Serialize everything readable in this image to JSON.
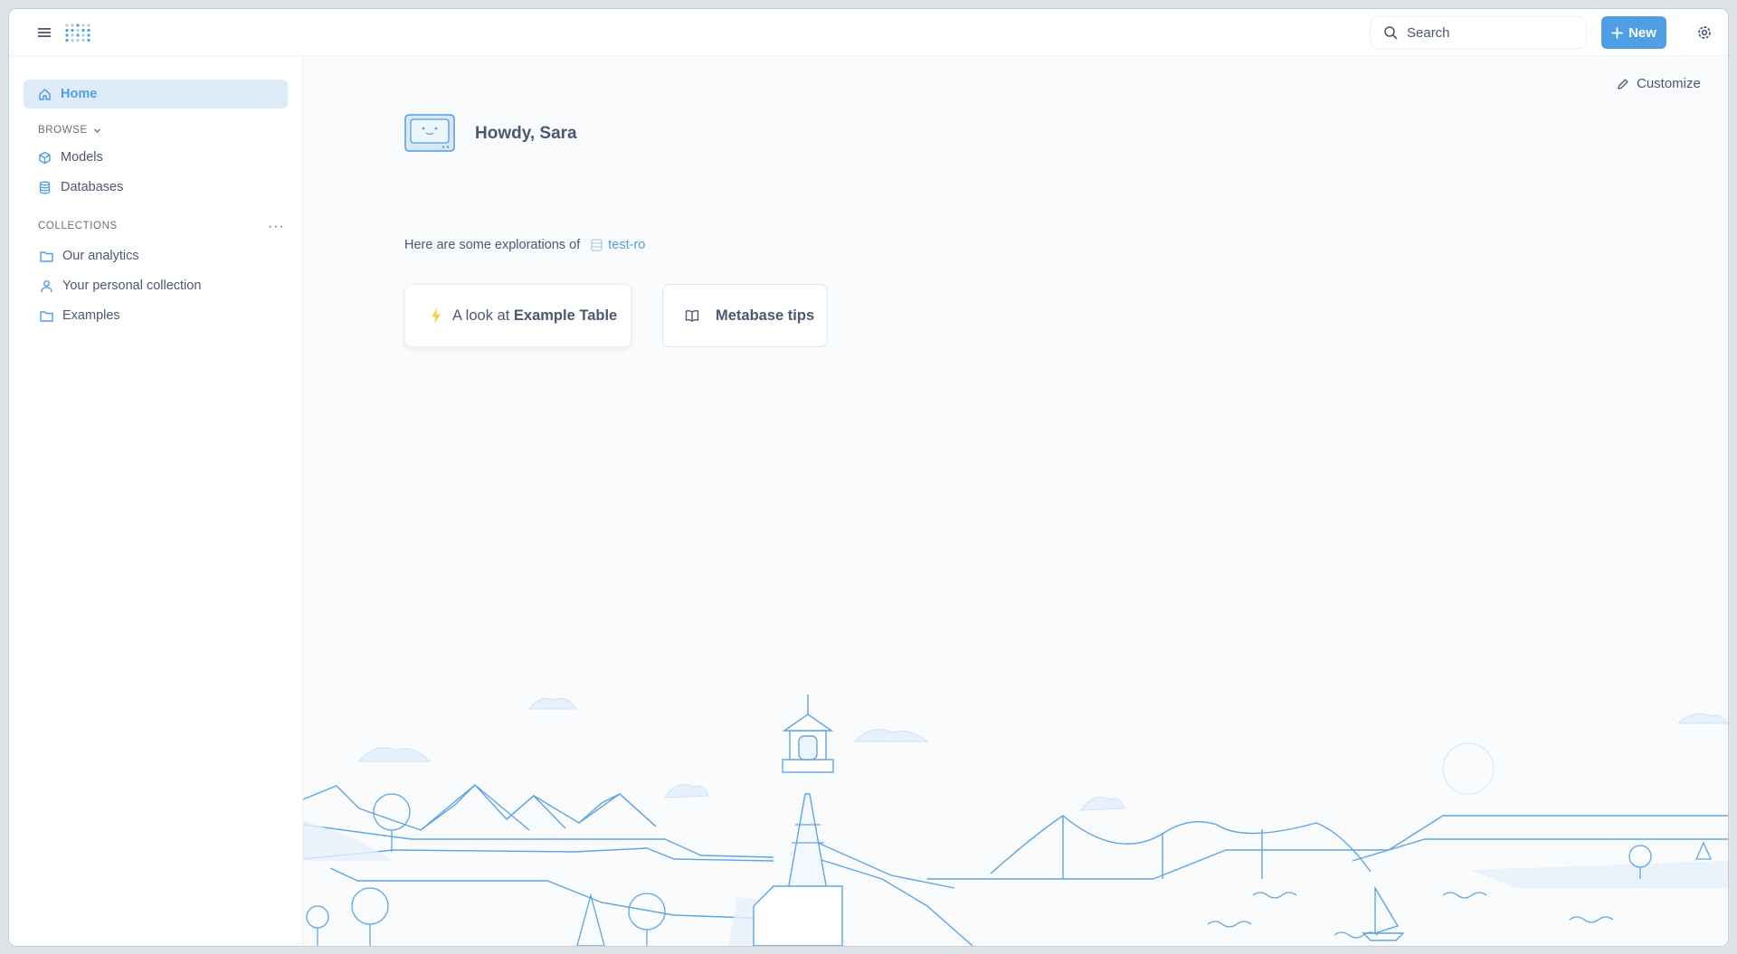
{
  "topbar": {
    "search_placeholder": "Search",
    "new_label": "New"
  },
  "sidebar": {
    "home_label": "Home",
    "browse_label": "BROWSE",
    "browse_items": [
      {
        "label": "Models"
      },
      {
        "label": "Databases"
      }
    ],
    "collections_label": "COLLECTIONS",
    "collection_items": [
      {
        "label": "Our analytics"
      },
      {
        "label": "Your personal collection"
      },
      {
        "label": "Examples"
      }
    ]
  },
  "main": {
    "customize_label": "Customize",
    "greeting": "Howdy, Sara",
    "explore_prefix": "Here are some explorations of",
    "database_name": "test-ro",
    "cards": {
      "xray_prefix": "A look at",
      "xray_table": "Example Table",
      "tips_label": "Metabase tips"
    }
  },
  "colors": {
    "brand": "#509ee3",
    "active_bg": "#deebf8",
    "text": "#4c5773",
    "lightning": "#f9cf48"
  }
}
